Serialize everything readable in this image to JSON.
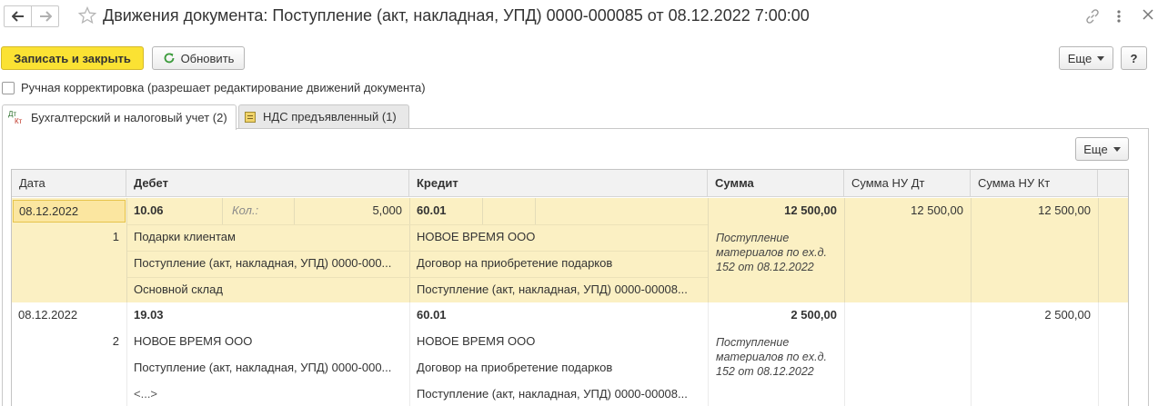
{
  "window": {
    "title": "Движения документа: Поступление (акт, накладная, УПД) 0000-000085 от 08.12.2022 7:00:00",
    "icons": [
      "back-arrow-icon",
      "forward-arrow-icon",
      "star-icon",
      "link-icon",
      "more-vertical-icon",
      "close-icon"
    ]
  },
  "toolbar": {
    "save_close_label": "Записать и закрыть",
    "refresh_label": "Обновить",
    "more_label": "Еще",
    "help_label": "?"
  },
  "manual_edit": {
    "label": "Ручная корректировка (разрешает редактирование движений документа)",
    "checked": false
  },
  "tabs": [
    {
      "label": "Бухгалтерский и налоговый учет (2)",
      "icon_text": "Дт Кт",
      "active": true
    },
    {
      "label": "НДС предъявленный (1)",
      "active": false
    }
  ],
  "grid": {
    "more_label": "Еще",
    "columns": [
      "Дата",
      "Дебет",
      "Кредит",
      "Сумма",
      "Сумма НУ Дт",
      "Сумма НУ Кт"
    ],
    "rows": [
      {
        "date": "08.12.2022",
        "number": "1",
        "debit_account": "10.06",
        "qty_label": "Кол.:",
        "qty_value": "5,000",
        "credit_account": "60.01",
        "amount": "12 500,00",
        "amount_nu_dt": "12 500,00",
        "amount_nu_kt": "12 500,00",
        "debit_sub": [
          "Подарки клиентам",
          "Поступление (акт, накладная, УПД) 0000-000...",
          "Основной склад"
        ],
        "credit_sub": [
          "НОВОЕ ВРЕМЯ ООО",
          "Договор на приобретение подарков",
          "Поступление (акт, накладная, УПД) 0000-00008..."
        ],
        "content": "Поступление материалов по ex.д. 152 от 08.12.2022"
      },
      {
        "date": "08.12.2022",
        "number": "2",
        "debit_account": "19.03",
        "credit_account": "60.01",
        "amount": "2 500,00",
        "amount_nu_dt": "",
        "amount_nu_kt": "2 500,00",
        "debit_sub": [
          "НОВОЕ ВРЕМЯ ООО",
          "Поступление (акт, накладная, УПД) 0000-000...",
          "<...>"
        ],
        "credit_sub": [
          "НОВОЕ ВРЕМЯ ООО",
          "Договор на приобретение подарков",
          "Поступление (акт, накладная, УПД) 0000-00008..."
        ],
        "content": "Поступление материалов по ex.д. 152 от 08.12.2022"
      }
    ]
  }
}
